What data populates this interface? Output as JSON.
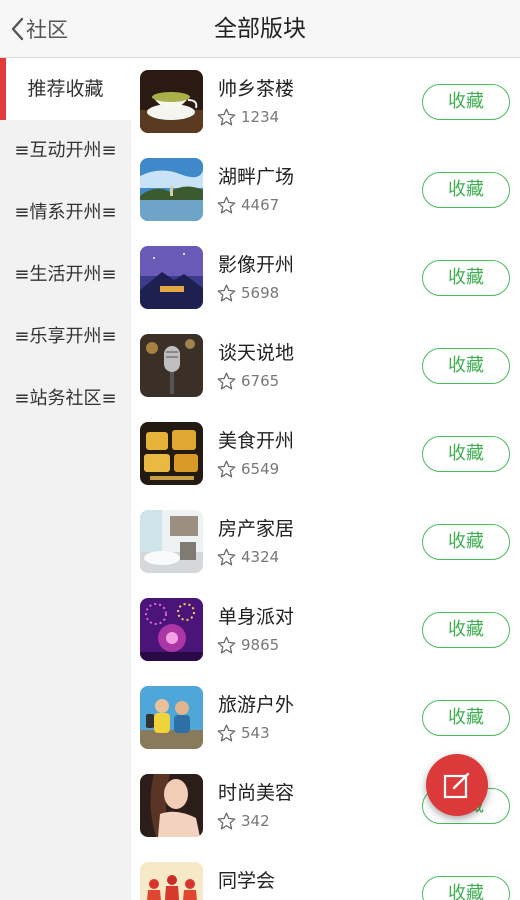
{
  "header": {
    "back_label": "社区",
    "title": "全部版块"
  },
  "sidebar": {
    "items": [
      {
        "label": "推荐收藏",
        "active": true
      },
      {
        "label": "≡互动开州≡",
        "active": false
      },
      {
        "label": "≡情系开州≡",
        "active": false
      },
      {
        "label": "≡生活开州≡",
        "active": false
      },
      {
        "label": "≡乐享开州≡",
        "active": false
      },
      {
        "label": "≡站务社区≡",
        "active": false
      }
    ]
  },
  "boards": [
    {
      "name": "帅乡茶楼",
      "count": "1234",
      "button": "收藏",
      "icon": "tea-cup-image"
    },
    {
      "name": "湖畔广场",
      "count": "4467",
      "button": "收藏",
      "icon": "lakeside-image"
    },
    {
      "name": "影像开州",
      "count": "5698",
      "button": "收藏",
      "icon": "night-mountain-image"
    },
    {
      "name": "谈天说地",
      "count": "6765",
      "button": "收藏",
      "icon": "microphone-image"
    },
    {
      "name": "美食开州",
      "count": "6549",
      "button": "收藏",
      "icon": "foodie-poster-image"
    },
    {
      "name": "房产家居",
      "count": "4324",
      "button": "收藏",
      "icon": "interior-room-image"
    },
    {
      "name": "单身派对",
      "count": "9865",
      "button": "收藏",
      "icon": "party-fireworks-image"
    },
    {
      "name": "旅游户外",
      "count": "543",
      "button": "收藏",
      "icon": "travelers-image"
    },
    {
      "name": "时尚美容",
      "count": "342",
      "button": "收藏",
      "icon": "fashion-portrait-image"
    },
    {
      "name": "同学会",
      "count": "",
      "button": "收藏",
      "icon": "classmates-image"
    }
  ],
  "fab": {
    "icon": "edit-icon"
  },
  "colors": {
    "accent_red": "#e23b3b",
    "favorite_green": "#4cbb5a",
    "sidebar_bg": "#f2f2f2"
  }
}
